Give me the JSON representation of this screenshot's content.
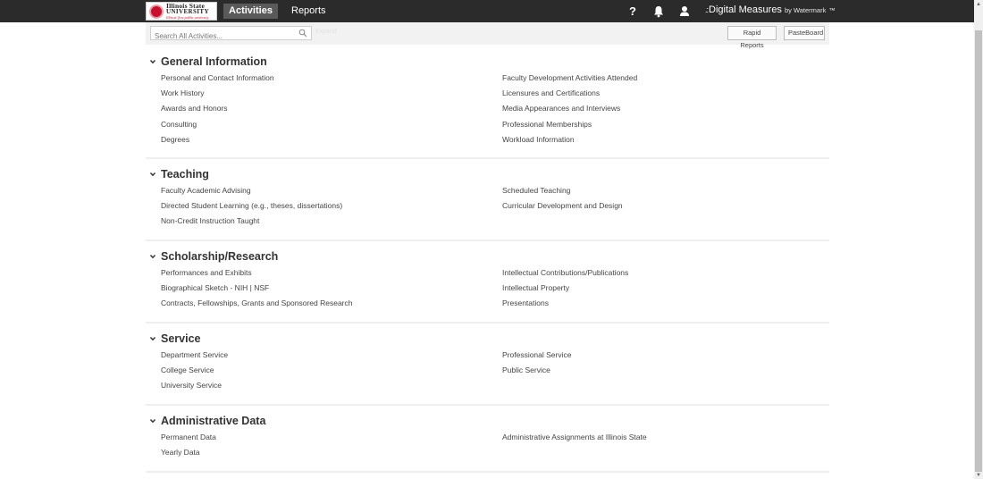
{
  "header": {
    "logo": {
      "line1": "Illinois State",
      "line2": "UNIVERSITY",
      "line3": "Illinois' first public university"
    },
    "tabs": [
      {
        "label": "Activities",
        "active": true
      },
      {
        "label": "Reports",
        "active": false
      }
    ],
    "icons": [
      "help-icon",
      "bell-icon",
      "user-icon"
    ],
    "help_glyph": "?",
    "brand": {
      "dots": ".:",
      "name": "Digital Measures",
      "by": "by Watermark",
      "tm": "™"
    }
  },
  "toolbar": {
    "search_placeholder": "Search All Activities...",
    "search_value": "",
    "expand_link": "Expand",
    "rapid_reports": "Rapid Reports",
    "pasteboard": "PasteBoard"
  },
  "sections": [
    {
      "title": "General Information",
      "left": [
        "Personal and Contact Information",
        "Work History",
        "Awards and Honors",
        "Consulting",
        "Degrees"
      ],
      "right": [
        "Faculty Development Activities Attended",
        "Licensures and Certifications",
        "Media Appearances and Interviews",
        "Professional Memberships",
        "Workload Information"
      ]
    },
    {
      "title": "Teaching",
      "left": [
        "Faculty Academic Advising",
        "Directed Student Learning (e.g., theses, dissertations)",
        "Non-Credit Instruction Taught"
      ],
      "right": [
        "Scheduled Teaching",
        "Curricular Development and Design"
      ]
    },
    {
      "title": "Scholarship/Research",
      "left": [
        "Performances and Exhibits",
        "Biographical Sketch - NIH | NSF",
        "Contracts, Fellowships, Grants and Sponsored Research"
      ],
      "right": [
        "Intellectual Contributions/Publications",
        "Intellectual Property",
        "Presentations"
      ]
    },
    {
      "title": "Service",
      "left": [
        "Department Service",
        "College Service",
        "University Service"
      ],
      "right": [
        "Professional Service",
        "Public Service"
      ]
    },
    {
      "title": "Administrative Data",
      "left": [
        "Permanent Data",
        "Yearly Data"
      ],
      "right": [
        "Administrative Assignments at Illinois State"
      ]
    }
  ],
  "colors": {
    "topbar": "#2b2b2b",
    "active_tab": "#5a5a5a",
    "toolbar": "#f2f2f2",
    "brand_red": "#c8102e"
  }
}
